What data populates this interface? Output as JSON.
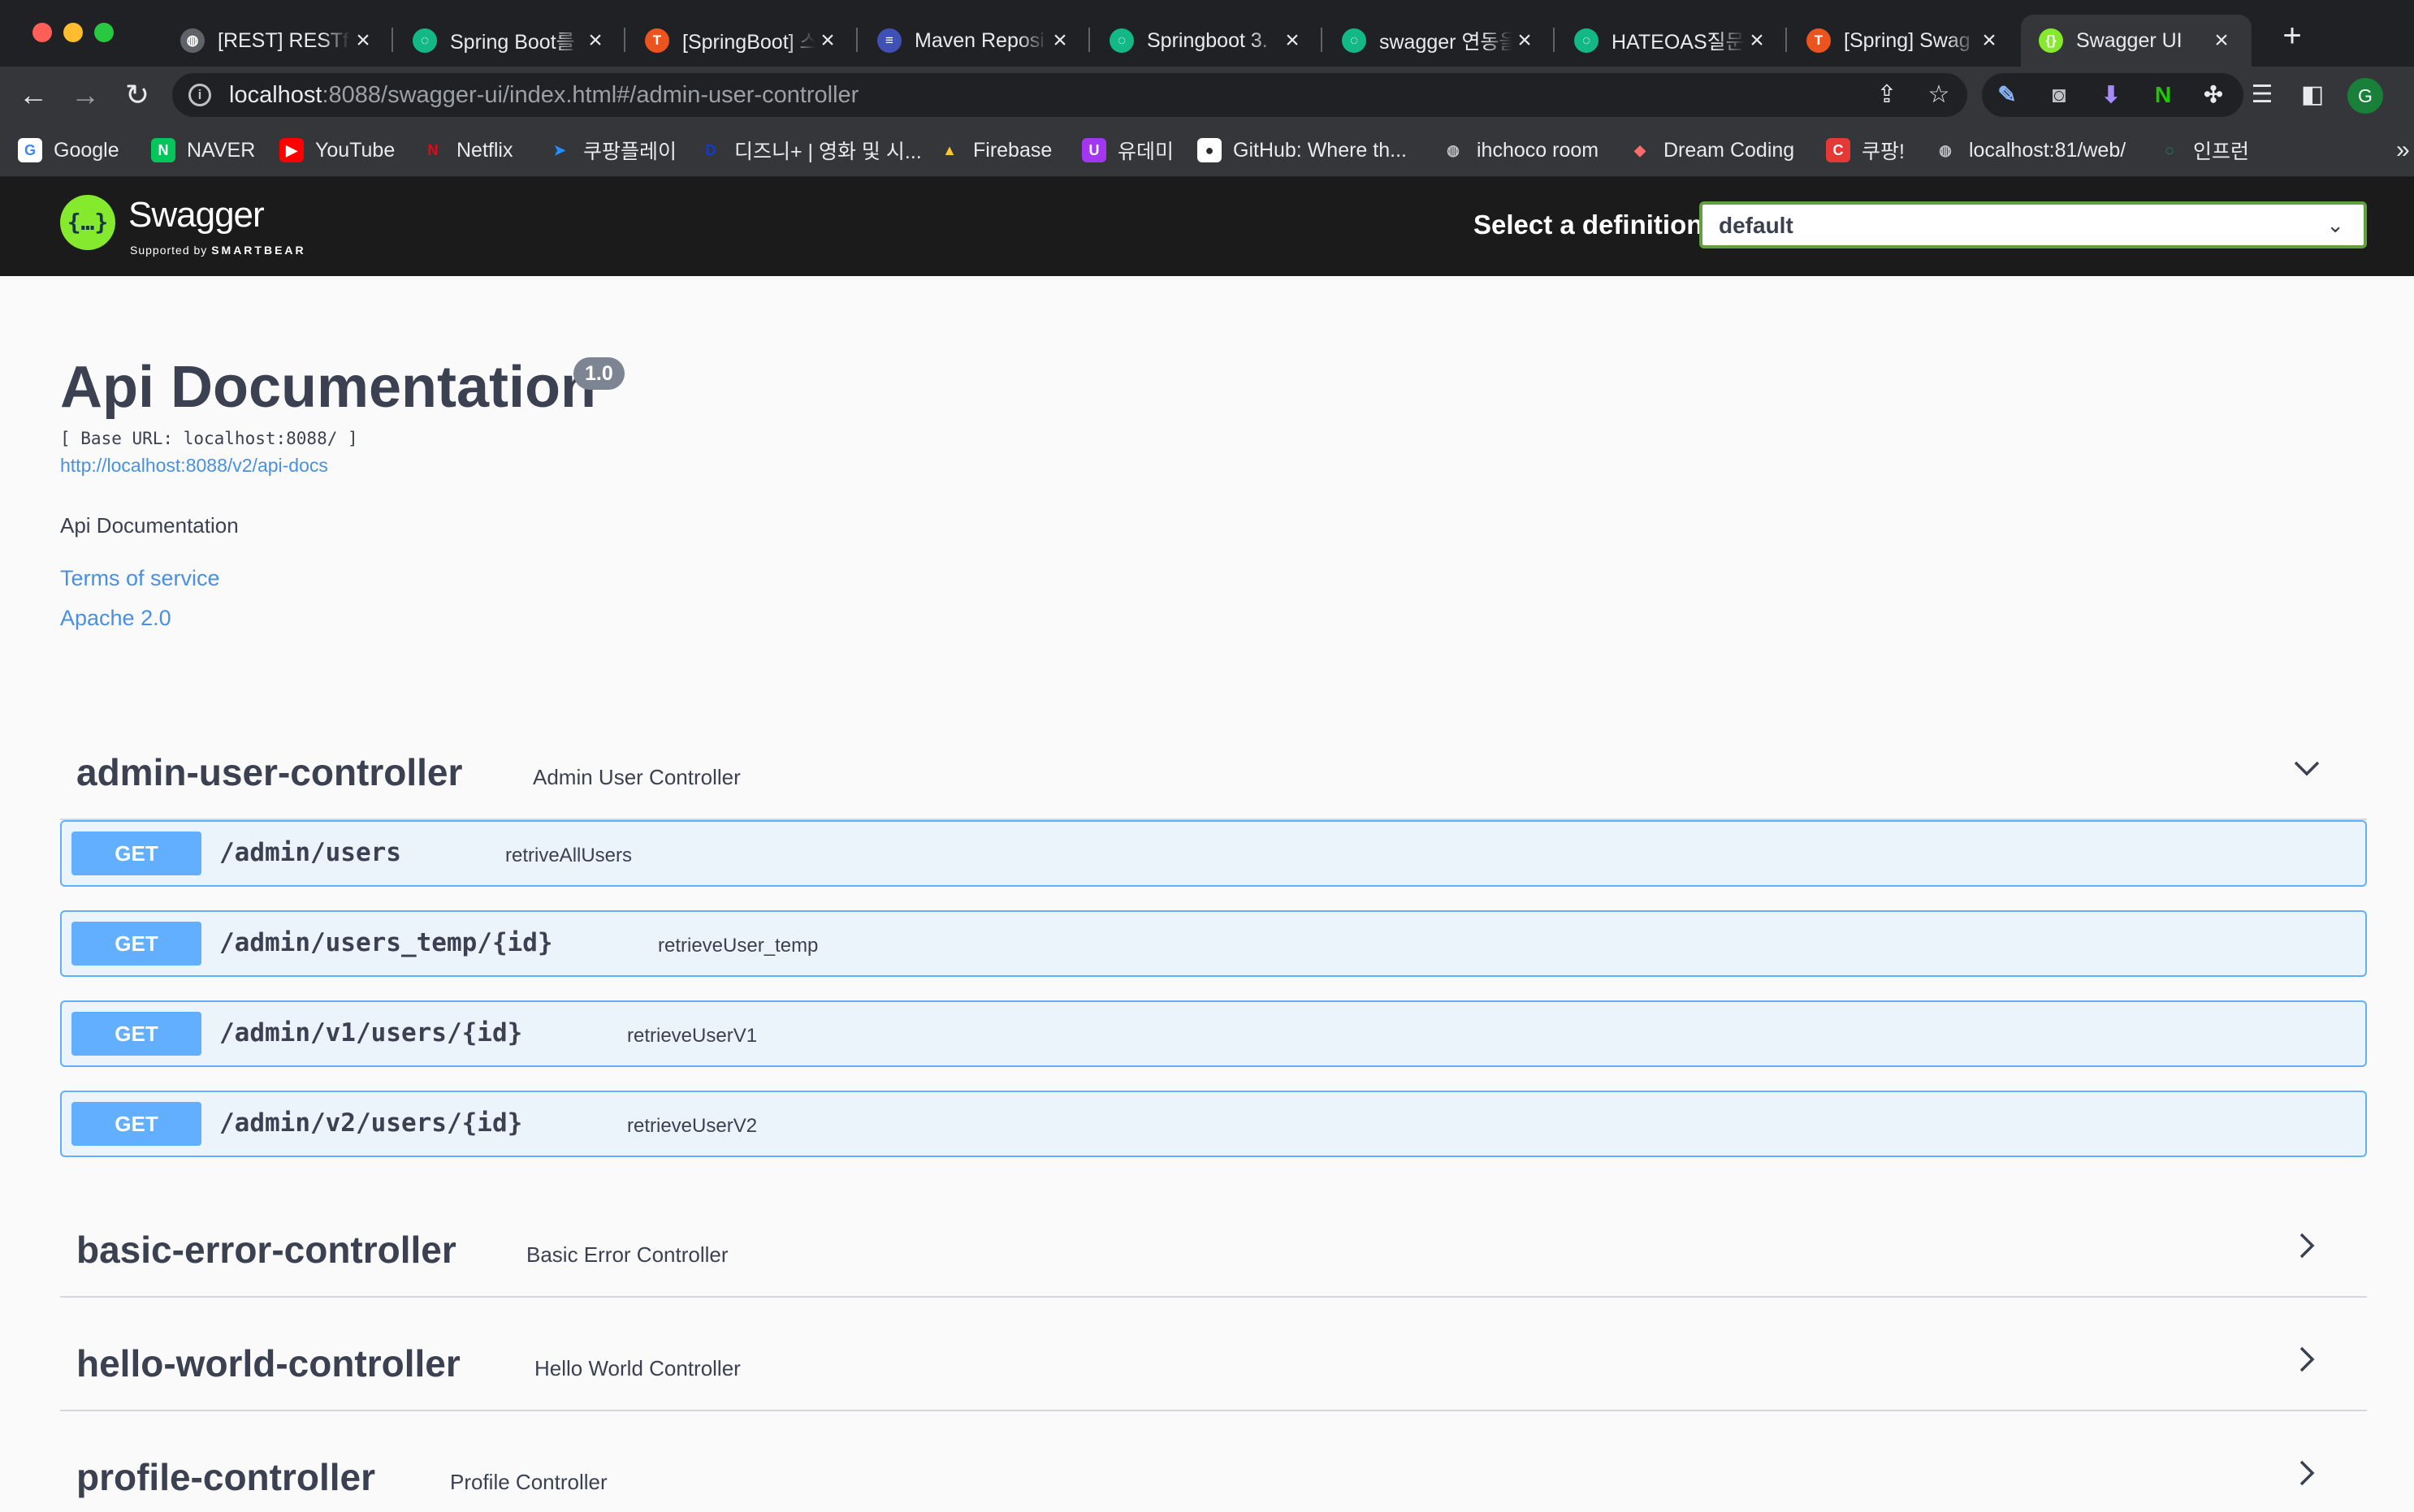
{
  "browser": {
    "tabs": [
      {
        "title": "[REST] RESTful",
        "favicon": "globe-icon",
        "color": "#5f6368",
        "glyph": "◍"
      },
      {
        "title": "Spring Boot를",
        "favicon": "velog-icon",
        "color": "#12b886",
        "glyph": "◌"
      },
      {
        "title": "[SpringBoot] 스",
        "favicon": "tistory-icon",
        "color": "#eb531f",
        "glyph": "T"
      },
      {
        "title": "Maven Reposi",
        "favicon": "maven-icon",
        "color": "#3f51b5",
        "glyph": "≡"
      },
      {
        "title": "Springboot 3.",
        "favicon": "velog-icon",
        "color": "#12b886",
        "glyph": "◌"
      },
      {
        "title": "swagger 연동을",
        "favicon": "velog-icon",
        "color": "#12b886",
        "glyph": "◌"
      },
      {
        "title": "HATEOAS질문",
        "favicon": "velog-icon",
        "color": "#12b886",
        "glyph": "◌"
      },
      {
        "title": "[Spring] Swag",
        "favicon": "tistory-icon",
        "color": "#eb531f",
        "glyph": "T"
      },
      {
        "title": "Swagger UI",
        "favicon": "swagger-icon",
        "color": "#85ea2d",
        "glyph": "{}",
        "active": true
      }
    ],
    "url": {
      "host": "localhost",
      "rest": ":8088/swagger-ui/index.html#/admin-user-controller"
    },
    "profile_initial": "G",
    "bookmarks": [
      {
        "label": "Google",
        "icon": "google-icon",
        "color": "#ffffff",
        "glyph": "G",
        "text": "#4285f4"
      },
      {
        "label": "NAVER",
        "icon": "naver-icon",
        "color": "#03c75a",
        "glyph": "N",
        "text": "#ffffff"
      },
      {
        "label": "YouTube",
        "icon": "youtube-icon",
        "color": "#ff0000",
        "glyph": "▶",
        "text": "#ffffff"
      },
      {
        "label": "Netflix",
        "icon": "netflix-icon",
        "color": "#35363a",
        "glyph": "N",
        "text": "#e50914"
      },
      {
        "label": "쿠팡플레이",
        "icon": "coupangplay-icon",
        "color": "#35363a",
        "glyph": "➤",
        "text": "#1e90ff"
      },
      {
        "label": "디즈니+ | 영화 및 시...",
        "icon": "disney-icon",
        "color": "#35363a",
        "glyph": "D",
        "text": "#113ccf"
      },
      {
        "label": "Firebase",
        "icon": "firebase-icon",
        "color": "#35363a",
        "glyph": "▲",
        "text": "#ffca28"
      },
      {
        "label": "유데미",
        "icon": "udemy-icon",
        "color": "#a435f0",
        "glyph": "U",
        "text": "#ffffff"
      },
      {
        "label": "GitHub: Where th...",
        "icon": "github-icon",
        "color": "#ffffff",
        "glyph": "●",
        "text": "#24292e"
      },
      {
        "label": "ihchoco room",
        "icon": "globe-icon",
        "color": "#35363a",
        "glyph": "◍",
        "text": "#bdc1c6"
      },
      {
        "label": "Dream Coding",
        "icon": "dreamcoding-icon",
        "color": "#35363a",
        "glyph": "◆",
        "text": "#ff6b6b"
      },
      {
        "label": "쿠팡!",
        "icon": "coupang-icon",
        "color": "#e53935",
        "glyph": "C",
        "text": "#ffffff"
      },
      {
        "label": "localhost:81/web/",
        "icon": "globe-icon",
        "color": "#35363a",
        "glyph": "◍",
        "text": "#bdc1c6"
      },
      {
        "label": "인프런",
        "icon": "inflearn-icon",
        "color": "#35363a",
        "glyph": "◌",
        "text": "#12b886"
      }
    ],
    "overflow_glyph": "»"
  },
  "swagger": {
    "logo_text": "Swagger",
    "logo_sub_prefix": "Supported by",
    "logo_sub_brand": "SMARTBEAR",
    "logo_glyph": "{…}",
    "definition_label": "Select a definition",
    "definition_value": "default"
  },
  "info": {
    "title": "Api Documentation",
    "version": "1.0",
    "base_url": "[ Base URL: localhost:8088/ ]",
    "docs_link": "http://localhost:8088/v2/api-docs",
    "description": "Api Documentation",
    "terms": "Terms of service",
    "license": "Apache 2.0"
  },
  "controllers": [
    {
      "name": "admin-user-controller",
      "description": "Admin User Controller",
      "expanded": true,
      "operations": [
        {
          "method": "GET",
          "path": "/admin/users",
          "summary": "retriveAllUsers"
        },
        {
          "method": "GET",
          "path": "/admin/users_temp/{id}",
          "summary": "retrieveUser_temp"
        },
        {
          "method": "GET",
          "path": "/admin/v1/users/{id}",
          "summary": "retrieveUserV1"
        },
        {
          "method": "GET",
          "path": "/admin/v2/users/{id}",
          "summary": "retrieveUserV2"
        }
      ]
    },
    {
      "name": "basic-error-controller",
      "description": "Basic Error Controller",
      "expanded": false
    },
    {
      "name": "hello-world-controller",
      "description": "Hello World Controller",
      "expanded": false
    },
    {
      "name": "profile-controller",
      "description": "Profile Controller",
      "expanded": false
    }
  ],
  "colors": {
    "get_method": "#61affe",
    "get_background": "#ebf3fb",
    "link": "#4990e2",
    "text": "#3b4151",
    "swagger_green": "#85ea2d"
  }
}
